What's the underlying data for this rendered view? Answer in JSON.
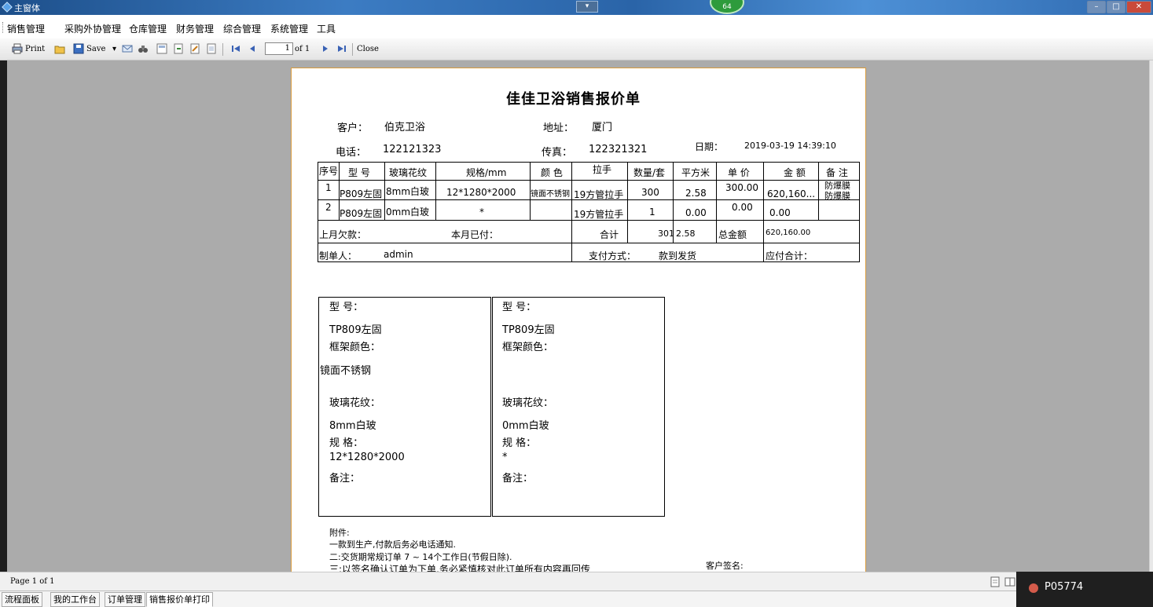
{
  "window": {
    "title": "主窗体",
    "badge": "64",
    "mid_button": "▾"
  },
  "menu": [
    "销售管理",
    "采购外协管理",
    "仓库管理",
    "财务管理",
    "综合管理",
    "系统管理",
    "工具"
  ],
  "toolbar": {
    "print": "Print",
    "save": "Save",
    "save_arrow": "▾",
    "page_value": "1",
    "page_of": "of 1",
    "close": "Close"
  },
  "report": {
    "title": "佳佳卫浴销售报价单",
    "customer_label": "客户：",
    "customer": "伯克卫浴",
    "address_label": "地址：",
    "address": "厦门",
    "phone_label": "电话：",
    "phone": "122121323",
    "fax_label": "传真：",
    "fax": "122321321",
    "date_label": "日期：",
    "date": "2019-03-19 14:39:10",
    "headers": [
      "序号",
      "型 号",
      "玻璃花纹",
      "规格/mm",
      "颜 色",
      "拉手",
      "数量/套",
      "平方米",
      "单 价",
      "金 额",
      "备 注"
    ],
    "rows": [
      {
        "no": "1",
        "model": "P809左固",
        "glass": "8mm白玻",
        "spec": "12*1280*2000",
        "color": "镜面不锈钢",
        "handle": "19方管拉手",
        "qty": "300",
        "sqm": "2.58",
        "price": "300.00",
        "amount": "620,160...",
        "note1": "防爆膜",
        "note2": "防爆膜"
      },
      {
        "no": "2",
        "model": "P809左固",
        "glass": "0mm白玻",
        "spec": "*",
        "color": "",
        "handle": "19方管拉手",
        "qty": "1",
        "sqm": "0.00",
        "price": "0.00",
        "amount": "0.00",
        "note1": "",
        "note2": ""
      }
    ],
    "last_month_label": "上月欠款：",
    "paid_label": "本月已付：",
    "total_label": "合计",
    "total_qty": "301",
    "total_sqm": "2.58",
    "grand_total_label": "总金额",
    "grand_total": "620,160.00",
    "maker_label": "制单人：",
    "maker": "admin",
    "payment_label": "支付方式：",
    "payment": "款到发货",
    "payable_label": "应付合计："
  },
  "cards": [
    {
      "model_label": "型 号：",
      "model": "TP809左固",
      "frame_label": "框架颜色：",
      "frame": "镜面不锈钢",
      "glass_label": "玻璃花纹：",
      "glass": "8mm白玻",
      "spec_label": "规 格：",
      "spec": "12*1280*2000",
      "note_label": "备注："
    },
    {
      "model_label": "型 号：",
      "model": "TP809左固",
      "frame_label": "框架颜色：",
      "frame": "",
      "glass_label": "玻璃花纹：",
      "glass": "0mm白玻",
      "spec_label": "规 格：",
      "spec": "*",
      "note_label": "备注："
    }
  ],
  "notes": {
    "heading": "附件:",
    "line1": "一款到生产,付款后务必电话通知.",
    "line2": "二:交货期常规订单 7 ~ 14个工作日(节假日除).",
    "line3": "三:以签名确认订单为下单,务必紧慎核对此订单所有内容再回传",
    "sign_label": "客户签名:"
  },
  "status": {
    "page": "Page 1 of 1"
  },
  "tabs": [
    "流程面板",
    "我的工作台",
    "订单管理",
    "销售报价单打印"
  ],
  "tray": {
    "user": "P05774"
  },
  "colors": {
    "title_bar": "#2a64a8",
    "paper_border": "#d99a3c",
    "viewer_bg": "#ababab"
  }
}
